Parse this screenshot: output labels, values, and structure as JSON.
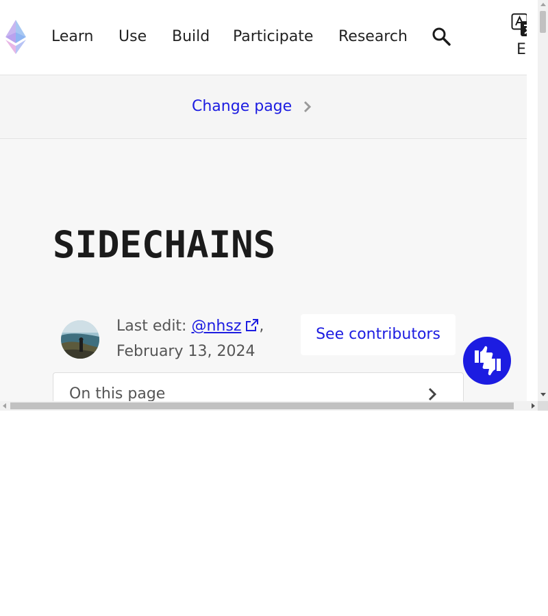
{
  "header": {
    "nav_items": [
      "Learn",
      "Use",
      "Build",
      "Participate",
      "Research"
    ],
    "language_code": "EN",
    "icons": {
      "logo": "ethereum-logo-icon",
      "search": "search-icon",
      "theme": "dark-mode-toggle-icon",
      "language": "translate-icon"
    }
  },
  "subnav": {
    "change_page_label": "Change page"
  },
  "main": {
    "title": "SIDECHAINS",
    "last_edit": {
      "prefix": "Last edit: ",
      "author": "@nhsz",
      "suffix": ",",
      "date": "February 13, 2024"
    },
    "see_contributors_label": "See contributors",
    "toc_label": "On this page"
  },
  "colors": {
    "accent": "#1c1ce1",
    "background": "#f7f7f7",
    "text": "#1b1b1b"
  }
}
